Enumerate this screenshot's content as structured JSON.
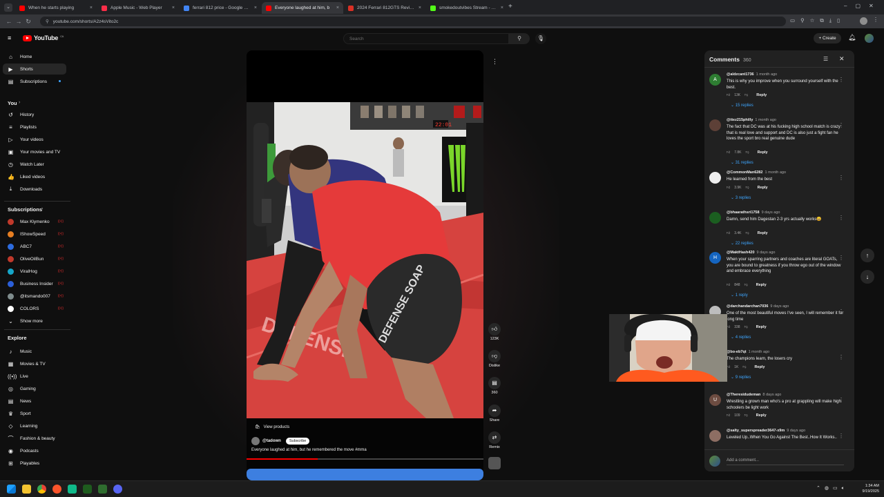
{
  "browser": {
    "tabs": [
      {
        "title": "When he starts playing",
        "color": "#ff0000",
        "active": false
      },
      {
        "title": "Apple Music - Web Player",
        "color": "#fa2d48",
        "active": false
      },
      {
        "title": "ferrari 812 price - Google Search",
        "color": "#4285f4",
        "active": false
      },
      {
        "title": "Everyone laughed at him, b",
        "color": "#ff0000",
        "active": true
      },
      {
        "title": "2024 Ferrari 812GTS Review, Pri",
        "color": "#d93025",
        "active": false
      },
      {
        "title": "smokedoutvibes Stream - Watch",
        "color": "#53fc18",
        "active": false
      }
    ],
    "new_tab": "+",
    "url": "youtube.com/shorts/A2z4sVito2c"
  },
  "youtube": {
    "logo": "YouTube",
    "region": "CA",
    "search_placeholder": "Search",
    "create_label": "Create",
    "sidebar": {
      "main": [
        {
          "label": "Home",
          "icon": "home-icon",
          "glyph": "⌂"
        },
        {
          "label": "Shorts",
          "icon": "shorts-icon",
          "glyph": "▶"
        },
        {
          "label": "Subscriptions",
          "icon": "subscriptions-icon",
          "glyph": "▤"
        }
      ],
      "you_header": "You",
      "you": [
        {
          "label": "History",
          "icon": "history-icon",
          "glyph": "↺"
        },
        {
          "label": "Playlists",
          "icon": "playlists-icon",
          "glyph": "≡"
        },
        {
          "label": "Your videos",
          "icon": "your-videos-icon",
          "glyph": "▷"
        },
        {
          "label": "Your movies and TV",
          "icon": "movies-icon",
          "glyph": "▣"
        },
        {
          "label": "Watch Later",
          "icon": "clock-icon",
          "glyph": "◷"
        },
        {
          "label": "Liked videos",
          "icon": "thumbs-up-icon",
          "glyph": "👍"
        },
        {
          "label": "Downloads",
          "icon": "download-icon",
          "glyph": "⤓"
        }
      ],
      "subs_header": "Subscriptions",
      "subs": [
        {
          "label": "Max Klymenko",
          "color": "#c0392b"
        },
        {
          "label": "IShowSpeed",
          "color": "#e67e22"
        },
        {
          "label": "ABC7",
          "color": "#2d6cdf"
        },
        {
          "label": "OliveOilBun",
          "color": "#c0392b"
        },
        {
          "label": "ViralHog",
          "color": "#16a6c9"
        },
        {
          "label": "Business Insider",
          "color": "#2b5fd9"
        },
        {
          "label": "@itsmando007",
          "color": "#7f8c8d"
        },
        {
          "label": "COLORS",
          "color": "#ffffff"
        }
      ],
      "show_more": "Show more",
      "explore_header": "Explore",
      "explore": [
        {
          "label": "Music",
          "icon": "music-icon",
          "glyph": "♪"
        },
        {
          "label": "Movies & TV",
          "icon": "film-icon",
          "glyph": "▦"
        },
        {
          "label": "Live",
          "icon": "live-icon",
          "glyph": "((•))"
        },
        {
          "label": "Gaming",
          "icon": "gaming-icon",
          "glyph": "◎"
        },
        {
          "label": "News",
          "icon": "news-icon",
          "glyph": "▤"
        },
        {
          "label": "Sport",
          "icon": "trophy-icon",
          "glyph": "♛"
        },
        {
          "label": "Learning",
          "icon": "learning-icon",
          "glyph": "◇"
        },
        {
          "label": "Fashion & beauty",
          "icon": "hanger-icon",
          "glyph": "⌒"
        },
        {
          "label": "Podcasts",
          "icon": "podcast-icon",
          "glyph": "◉"
        },
        {
          "label": "Playables",
          "icon": "playables-icon",
          "glyph": "⊞"
        }
      ]
    },
    "short": {
      "view_products": "View products",
      "channel": "@tadown",
      "subscribe": "Subscribe",
      "caption": "Everyone laughed at him, but he remembered the move #mma",
      "likes": "123K",
      "dislike": "Dislike",
      "comments_count": "360",
      "share": "Share",
      "remix": "Remix",
      "progress": 0.3
    },
    "comments": {
      "title": "Comments",
      "count": "360",
      "add_placeholder": "Add a comment...",
      "reply_label": "Reply",
      "items": [
        {
          "author": "@aldzcant1736",
          "time": "1 month ago",
          "text": "This is why you improve when you surround yourself with the best.",
          "likes": "13K",
          "replies": "15 replies",
          "avatar": "A",
          "color": "#2e7d32"
        },
        {
          "author": "@ttez215philly",
          "time": "1 month ago",
          "text": "The fact that DC was at his fucking high school match is crazy that is real love and support and DC is also just a fight fan he loves the sport bro real genuine dude",
          "likes": "7.8K",
          "replies": "31 replies",
          "avatar": "",
          "color": "#5d4037"
        },
        {
          "author": "@CommonMan6282",
          "time": "1 month ago",
          "text": "He learned from the best",
          "likes": "3.9K",
          "replies": "3 replies",
          "avatar": "",
          "color": "#eeeeee"
        },
        {
          "author": "@bhaarathsri1758",
          "time": "9 days ago",
          "text": "Damn, send him Dagestan 2-3 yrs actually works😀",
          "likes": "3.4K",
          "replies": "22 replies",
          "avatar": "",
          "color": "#1b5e20"
        },
        {
          "author": "@MaktHash420",
          "time": "9 days ago",
          "text": "When your sparring partners and coaches are literal GOATs, you are bound to greatness if you throw ego out of the window and embrace everything",
          "likes": "848",
          "replies": "1 reply",
          "avatar": "H",
          "color": "#1565c0"
        },
        {
          "author": "@darchandarchan7036",
          "time": "9 days ago",
          "text": "One of the most beautiful moves I've seen, I will remember it for long time",
          "likes": "338",
          "replies": "4 replies",
          "avatar": "",
          "color": "#bdbdbd"
        },
        {
          "author": "@bo-eb7qt",
          "time": "1 month ago",
          "text": "The champions learn, the losers cry",
          "likes": "1K",
          "replies": "9 replies",
          "avatar": "",
          "color": "#424242"
        },
        {
          "author": "@Theresidudeman",
          "time": "8 days ago",
          "text": "Wrestling a grown man who's a pro at grappling will make high schoolers be light work",
          "likes": "109",
          "replies": "",
          "avatar": "U",
          "color": "#6d4c41"
        },
        {
          "author": "@salty_superspreader3647-x9m",
          "time": "9 days ago",
          "text": "Leveled Up..When You Go Against The Best..How It Works..",
          "likes": "",
          "replies": "",
          "avatar": "",
          "color": "#8d6e63"
        }
      ]
    }
  },
  "taskbar": {
    "time": "1:34 AM",
    "date": "9/19/2025"
  }
}
